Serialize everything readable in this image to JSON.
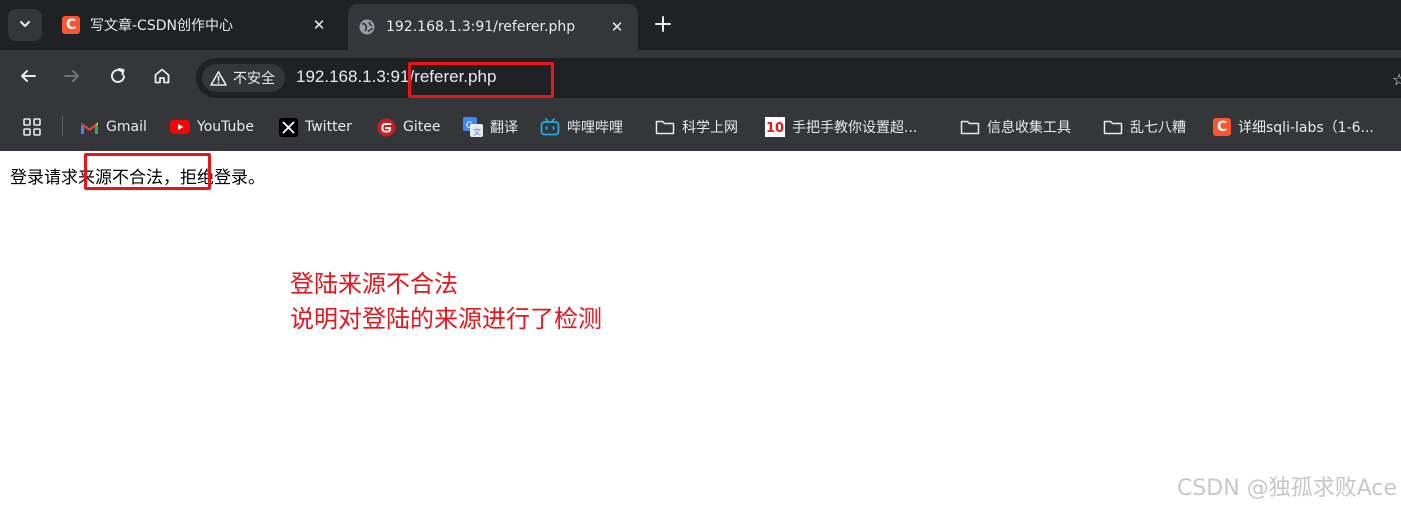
{
  "tabs": [
    {
      "title": "写文章-CSDN创作中心",
      "favicon": "csdn-icon",
      "active": false
    },
    {
      "title": "192.168.1.3:91/referer.php",
      "favicon": "globe-icon",
      "active": true
    }
  ],
  "toolbar": {
    "security_label": "不安全",
    "url_host": "192.168.1.3:91",
    "url_path": "/referer.php"
  },
  "bookmarks": [
    {
      "label": "Gmail",
      "icon": "gmail-icon"
    },
    {
      "label": "YouTube",
      "icon": "youtube-icon"
    },
    {
      "label": "Twitter",
      "icon": "x-icon"
    },
    {
      "label": "Gitee",
      "icon": "gitee-icon"
    },
    {
      "label": "翻译",
      "icon": "translate-icon"
    },
    {
      "label": "哔哩哔哩",
      "icon": "bilibili-icon"
    },
    {
      "label": "科学上网",
      "icon": "folder-icon"
    },
    {
      "label": "手把手教你设置超...",
      "icon": "tenx-icon"
    },
    {
      "label": "信息收集工具",
      "icon": "folder-icon"
    },
    {
      "label": "乱七八糟",
      "icon": "folder-icon"
    },
    {
      "label": "详细sqli-labs（1-6...",
      "icon": "csdn-icon"
    }
  ],
  "content": {
    "message_before": "登录请求",
    "message_highlight": "来源不合法，",
    "message_after": "拒绝登录。"
  },
  "annotation": {
    "line1": "登陆来源不合法",
    "line2": "说明对登陆的来源进行了检测"
  },
  "watermark": "CSDN @独孤求败Ace",
  "colors": {
    "annotation_red": "#e8151b",
    "chrome_dark": "#202124",
    "toolbar": "#35363a",
    "csdn_orange": "#fc5531"
  }
}
